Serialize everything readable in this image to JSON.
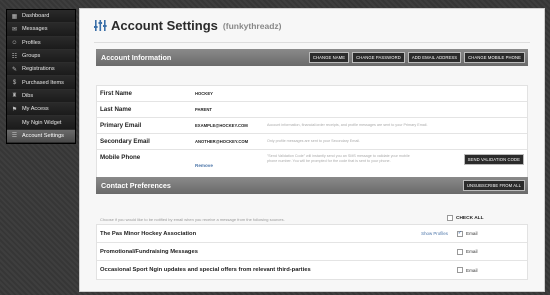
{
  "sidebar": {
    "items": [
      {
        "label": "Dashboard",
        "icon": "dashboard-icon",
        "glyph": "▦"
      },
      {
        "label": "Messages",
        "icon": "envelope-icon",
        "glyph": "✉"
      },
      {
        "label": "Profiles",
        "icon": "person-icon",
        "glyph": "☺"
      },
      {
        "label": "Groups",
        "icon": "group-icon",
        "glyph": "☷"
      },
      {
        "label": "Registrations",
        "icon": "pencil-icon",
        "glyph": "✎"
      },
      {
        "label": "Purchased Items",
        "icon": "dollar-icon",
        "glyph": "$"
      },
      {
        "label": "Dibs",
        "icon": "trophy-icon",
        "glyph": "♜"
      },
      {
        "label": "My Access",
        "icon": "access-icon",
        "glyph": "⚑"
      },
      {
        "label": "My Ngin Widget",
        "icon": "",
        "glyph": ""
      },
      {
        "label": "Account Settings",
        "icon": "settings-icon",
        "glyph": "☰"
      }
    ],
    "active_index": 9
  },
  "header": {
    "title": "Account Settings",
    "username": "(funkythreadz)"
  },
  "account_info": {
    "heading": "Account Information",
    "buttons": [
      "CHANGE NAME",
      "CHANGE PASSWORD",
      "ADD EMAIL ADDRESS",
      "CHANGE MOBILE PHONE"
    ],
    "rows": {
      "first_name": {
        "label": "First Name",
        "value": "HOCKEY"
      },
      "last_name": {
        "label": "Last Name",
        "value": "PARENT"
      },
      "primary_email": {
        "label": "Primary Email",
        "value": "EXAMPLE@HOCKEY.COM",
        "note": "Account information, financial/order receipts, and profile messages are sent to your Primary Email."
      },
      "secondary_email": {
        "label": "Secondary Email",
        "value": "ANOTHER@HOCKEY.COM",
        "note": "Only profile messages are sent to your Secondary Email."
      },
      "mobile_phone": {
        "label": "Mobile Phone",
        "remove": "Remove",
        "note": "\"Send Validation Code\" will instantly send you an SMS message to validate your mobile phone number. You will be prompted for the code that is sent to your phone.",
        "button": "SEND VALIDATION CODE"
      }
    }
  },
  "contact_prefs": {
    "heading": "Contact Preferences",
    "button": "UNSUBSCRIBE FROM ALL",
    "intro": "Choose if you would like to be notified by email when you receive a message from the following sources.",
    "check_all": "CHECK ALL",
    "rows": [
      {
        "label": "The Pas Minor Hockey Association",
        "link": "Show Profiles",
        "option": "Email",
        "checked": true
      },
      {
        "label": "Promotional/Fundraising Messages",
        "link": "",
        "option": "Email",
        "checked": false
      },
      {
        "label": "Occasional Sport Ngin updates and special offers from relevant third-parties",
        "link": "",
        "option": "Email",
        "checked": false
      }
    ]
  }
}
